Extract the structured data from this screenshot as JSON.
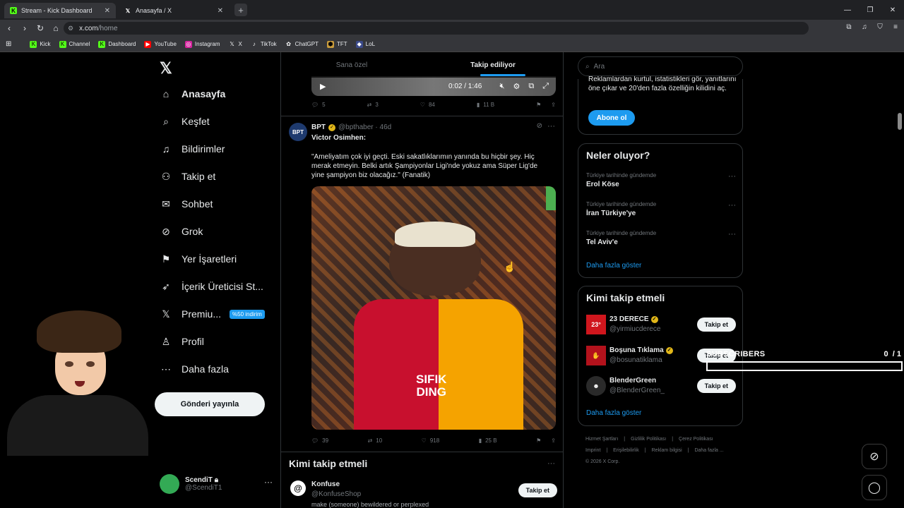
{
  "browser": {
    "tabs": [
      {
        "title": "Stream - Kick Dashboard",
        "favicon": "kick-icon",
        "active": false
      },
      {
        "title": "Anasayfa / X",
        "favicon": "x-icon",
        "active": true
      }
    ],
    "url_host": "x.com",
    "url_path": "/home",
    "bookmarks": [
      "Kick",
      "Channel",
      "Dashboard",
      "YouTube",
      "Instagram",
      "X",
      "TikTok",
      "ChatGPT",
      "TFT",
      "LoL"
    ]
  },
  "nav": {
    "items": [
      {
        "label": "Anasayfa",
        "icon": "home-icon"
      },
      {
        "label": "Keşfet",
        "icon": "search-icon"
      },
      {
        "label": "Bildirimler",
        "icon": "bell-icon"
      },
      {
        "label": "Takip et",
        "icon": "person-plus-icon"
      },
      {
        "label": "Sohbet",
        "icon": "mail-icon"
      },
      {
        "label": "Grok",
        "icon": "grok-icon"
      },
      {
        "label": "Yer İşaretleri",
        "icon": "bookmark-icon"
      },
      {
        "label": "İçerik Üreticisi St...",
        "icon": "rocket-icon"
      },
      {
        "label": "Premiu...",
        "icon": "x-icon"
      },
      {
        "label": "Profil",
        "icon": "person-icon"
      },
      {
        "label": "Daha fazla",
        "icon": "more-circle-icon"
      }
    ],
    "premium_badge": "%50 indirim",
    "post_button": "Gönderi yayınla",
    "account": {
      "name": "ScendiT",
      "handle": "@ScendiT1"
    }
  },
  "feed": {
    "tabs": [
      "Sana özel",
      "Takip ediliyor"
    ],
    "video": {
      "time": "0:02 / 1:46"
    },
    "prev_actions": {
      "replies": "5",
      "reposts": "3",
      "likes": "84",
      "views": "11 B"
    },
    "tweet": {
      "avatar_text": "BPT",
      "name": "BPT",
      "handle": "@bpthaber · 46d",
      "title": "Victor Osimhen:",
      "body": "\"Ameliyatım çok iyi geçti. Eski sakatlıklarımın yanında bu hiçbir şey. Hiç merak etmeyin. Belki artık Şampiyonlar Ligi'nde yokuz ama Süper Lig'de yine şampiyon biz olacağız.\" (Fanatik)",
      "jersey_text_1": "SIFIK",
      "jersey_text_2": "DING",
      "actions": {
        "replies": "39",
        "reposts": "10",
        "likes": "918",
        "views": "25 B"
      }
    },
    "who_to_follow": {
      "title": "Kimi takip etmeli",
      "account": {
        "name": "Konfuse",
        "handle": "@KonfuseShop",
        "bio": "make (someone) bewildered or perplexed",
        "button": "Takip et"
      }
    }
  },
  "sidebar": {
    "search_placeholder": "Ara",
    "premium_text": "Reklamlardan kurtul, istatistikleri gör, yanıtlarını öne çıkar ve 20'den fazla özelliğin kilidini aç.",
    "premium_button": "Abone ol",
    "trends": {
      "title": "Neler oluyor?",
      "items": [
        {
          "context": "Türkiye tarihinde gündemde",
          "topic": "Erol Köse"
        },
        {
          "context": "Türkiye tarihinde gündemde",
          "topic": "İran Türkiye'ye"
        },
        {
          "context": "Türkiye tarihinde gündemde",
          "topic": "Tel Aviv'e"
        }
      ],
      "show_more": "Daha fazla göster"
    },
    "follow": {
      "title": "Kimi takip etmeli",
      "items": [
        {
          "name": "23 DERECE",
          "handle": "@yirmiucderece",
          "avatar_text": "23°",
          "avatar_color": "#d0161d",
          "button": "Takip et"
        },
        {
          "name": "Boşuna Tıklama",
          "handle": "@bosunatiklama",
          "avatar_text": "✋",
          "avatar_color": "#b3121c",
          "button": "Takip et"
        },
        {
          "name": "BlenderGreen",
          "handle": "@BlenderGreen_",
          "avatar_text": "☻",
          "avatar_color": "#2a2a2a",
          "button": "Takip et"
        }
      ],
      "show_more": "Daha fazla göster"
    },
    "footer": [
      "Hizmet Şartları",
      "Gizlilik Politikası",
      "Çerez Politikası",
      "Imprint",
      "Erişilebilirlik",
      "Reklam bilgisi",
      "Daha fazla ...",
      "© 2026 X Corp."
    ]
  },
  "overlay": {
    "subs_label": "SUBSCRIBERS",
    "subs_count": "0",
    "subs_goal": "/ 1",
    "subs_progress": 0
  },
  "colors": {
    "accent": "#1d9bf0",
    "bg": "#000000",
    "border": "#2f3336"
  }
}
